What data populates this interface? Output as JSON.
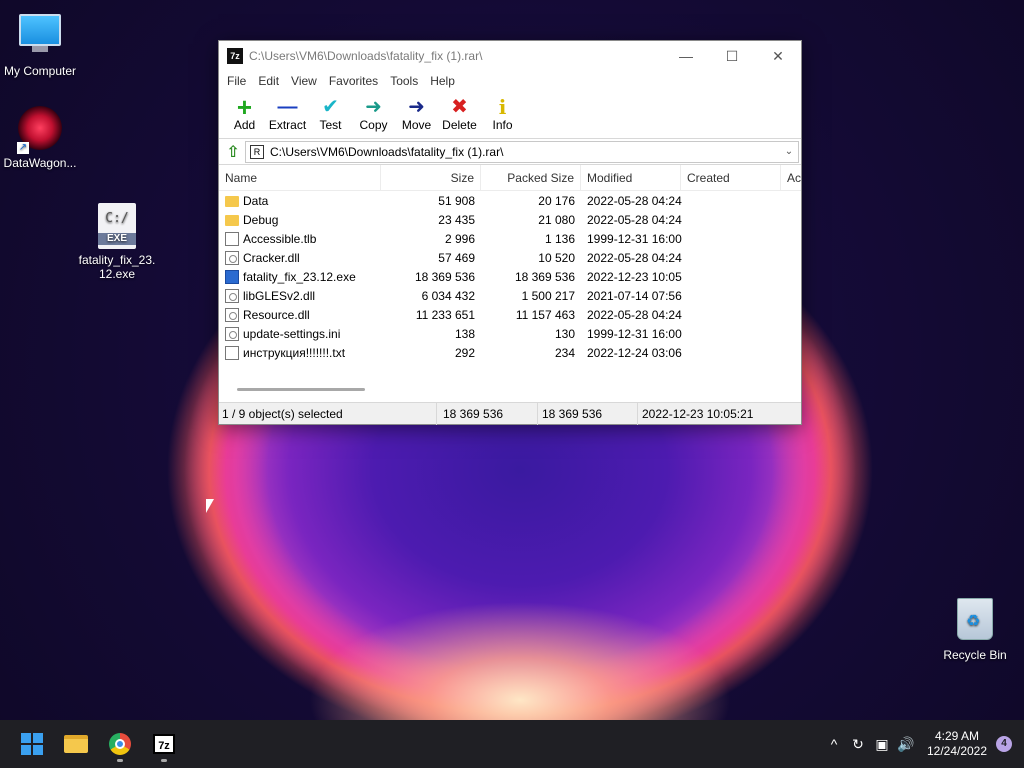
{
  "desktop": {
    "icons": [
      {
        "label": "My Computer",
        "icon": "monitor-icon"
      },
      {
        "label": "DataWagon...",
        "icon": "datawagon-icon"
      },
      {
        "label": "fatality_fix_23.12.exe",
        "icon": "exe-file-icon",
        "badge": "EXE",
        "glyph": "C:/"
      },
      {
        "label": "Recycle Bin",
        "icon": "recycle-bin-icon"
      }
    ]
  },
  "window": {
    "app_icon": "7z",
    "title": "C:\\Users\\VM6\\Downloads\\fatality_fix (1).rar\\",
    "controls": {
      "minimize": "—",
      "maximize": "☐",
      "close": "✕"
    },
    "menu": [
      "File",
      "Edit",
      "View",
      "Favorites",
      "Tools",
      "Help"
    ],
    "toolbar": [
      {
        "label": "Add",
        "icon": "add-icon",
        "glyph": "+",
        "color": "#1fa81f"
      },
      {
        "label": "Extract",
        "icon": "extract-icon",
        "glyph": "—",
        "color": "#1a3fc0"
      },
      {
        "label": "Test",
        "icon": "test-icon",
        "glyph": "✔",
        "color": "#1ab5c8"
      },
      {
        "label": "Copy",
        "icon": "copy-icon",
        "glyph": "➜",
        "color": "#1a9a8a"
      },
      {
        "label": "Move",
        "icon": "move-icon",
        "glyph": "➜",
        "color": "#1a2a8a"
      },
      {
        "label": "Delete",
        "icon": "delete-icon",
        "glyph": "✖",
        "color": "#d82020"
      },
      {
        "label": "Info",
        "icon": "info-icon",
        "glyph": "i",
        "color": "#d8b800"
      }
    ],
    "address": "C:\\Users\\VM6\\Downloads\\fatality_fix (1).rar\\",
    "columns": [
      "Name",
      "Size",
      "Packed Size",
      "Modified",
      "Created",
      "Ac"
    ],
    "files": [
      {
        "name": "Data",
        "type": "folder",
        "size": "51 908",
        "packed": "20 176",
        "modified": "2022-05-28 04:24",
        "created": ""
      },
      {
        "name": "Debug",
        "type": "folder",
        "size": "23 435",
        "packed": "21 080",
        "modified": "2022-05-28 04:24",
        "created": ""
      },
      {
        "name": "Accessible.tlb",
        "type": "doc",
        "size": "2 996",
        "packed": "1 136",
        "modified": "1999-12-31 16:00",
        "created": ""
      },
      {
        "name": "Cracker.dll",
        "type": "dll",
        "size": "57 469",
        "packed": "10 520",
        "modified": "2022-05-28 04:24",
        "created": ""
      },
      {
        "name": "fatality_fix_23.12.exe",
        "type": "exe",
        "size": "18 369 536",
        "packed": "18 369 536",
        "modified": "2022-12-23 10:05",
        "created": ""
      },
      {
        "name": "libGLESv2.dll",
        "type": "dll",
        "size": "6 034 432",
        "packed": "1 500 217",
        "modified": "2021-07-14 07:56",
        "created": ""
      },
      {
        "name": "Resource.dll",
        "type": "dll",
        "size": "11 233 651",
        "packed": "11 157 463",
        "modified": "2022-05-28 04:24",
        "created": ""
      },
      {
        "name": "update-settings.ini",
        "type": "dll",
        "size": "138",
        "packed": "130",
        "modified": "1999-12-31 16:00",
        "created": ""
      },
      {
        "name": "инструкция!!!!!!!.txt",
        "type": "doc",
        "size": "292",
        "packed": "234",
        "modified": "2022-12-24 03:06",
        "created": ""
      }
    ],
    "status": {
      "selection": "1 / 9 object(s) selected",
      "size": "18 369 536",
      "packed": "18 369 536",
      "modified": "2022-12-23 10:05:21"
    }
  },
  "taskbar": {
    "apps": [
      {
        "name": "start",
        "icon": "windows-start-icon"
      },
      {
        "name": "file-explorer",
        "icon": "folder-icon"
      },
      {
        "name": "chrome",
        "icon": "chrome-icon"
      },
      {
        "name": "7-zip",
        "icon": "7zip-icon",
        "glyph": "7z"
      }
    ],
    "tray": {
      "chevron": "^",
      "time": "4:29 AM",
      "date": "12/24/2022",
      "notifications": "4"
    }
  }
}
